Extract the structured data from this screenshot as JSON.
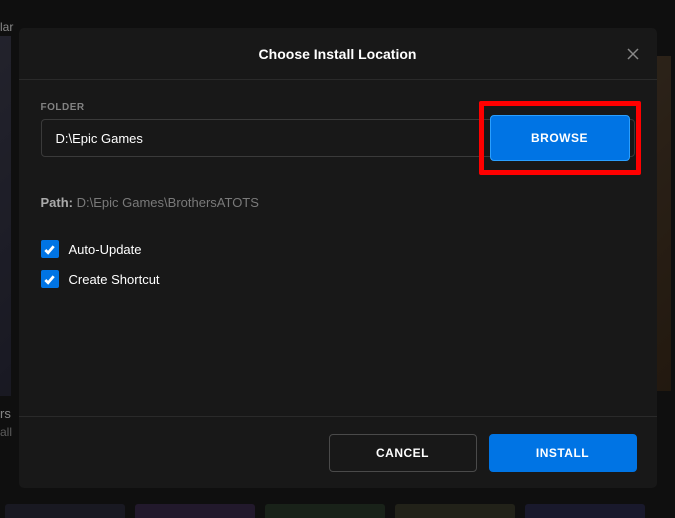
{
  "modal": {
    "title": "Choose Install Location",
    "folder_label": "FOLDER",
    "folder_value": "D:\\Epic Games",
    "browse_label": "BROWSE",
    "path_label": "Path: ",
    "path_value": "D:\\Epic Games\\BrothersATOTS",
    "checkboxes": [
      {
        "label": "Auto-Update",
        "checked": true
      },
      {
        "label": "Create Shortcut",
        "checked": true
      }
    ],
    "cancel_label": "CANCEL",
    "install_label": "INSTALL"
  },
  "background": {
    "label_top": "lar",
    "label_left1": "rs",
    "label_left2": "all"
  },
  "colors": {
    "accent": "#0074e4",
    "highlight": "#ff0000"
  }
}
